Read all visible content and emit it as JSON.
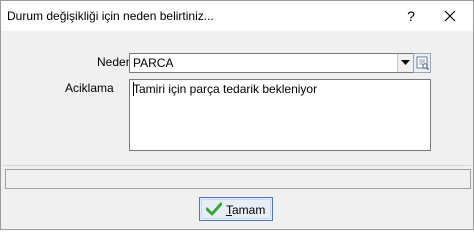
{
  "window": {
    "title": "Durum değişikliği için neden belirtiniz...",
    "help_label": "?"
  },
  "form": {
    "neden_label": "Neden",
    "neden_value": "PARCA",
    "aciklama_label": "Aciklama",
    "aciklama_value": "Tamiri için parça tedarik bekleniyor"
  },
  "footer": {
    "status_text": "",
    "ok_label_first": "T",
    "ok_label_rest": "amam"
  },
  "icons": {
    "close": "close-icon",
    "help": "help-icon",
    "dropdown": "chevron-down-icon",
    "lookup": "lookup-icon",
    "ok": "checkmark-icon"
  },
  "colors": {
    "title_bg": "#ffffff",
    "client_bg": "#f0f0f0",
    "ok_border": "#4a78b8",
    "checkmark": "#3aa63a"
  }
}
